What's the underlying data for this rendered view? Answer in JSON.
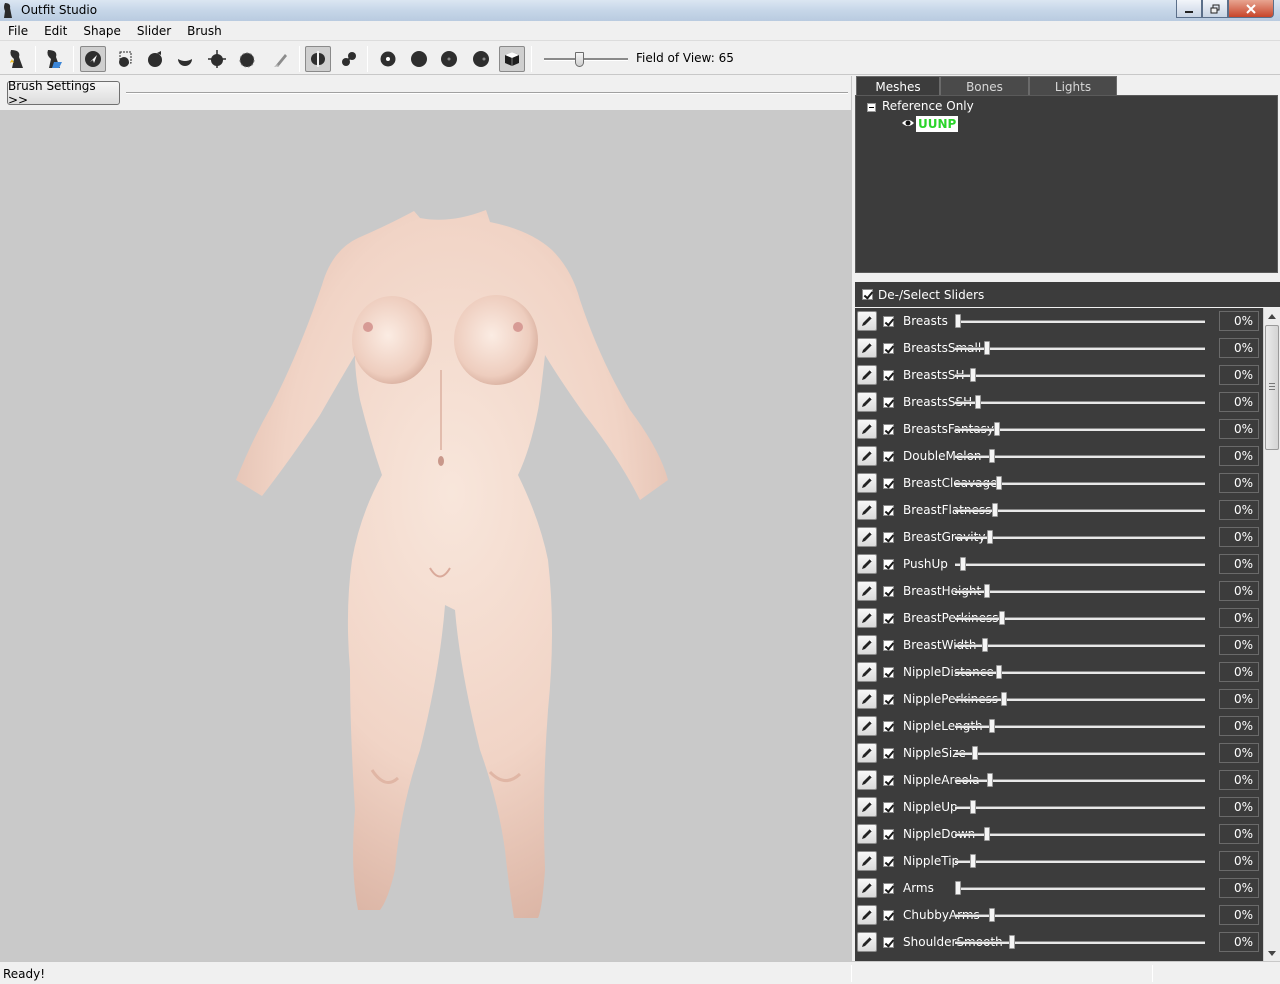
{
  "window": {
    "title": "Outfit Studio",
    "controls": [
      "minimize",
      "maximize",
      "close"
    ]
  },
  "menu": [
    "File",
    "Edit",
    "Shape",
    "Slider",
    "Brush"
  ],
  "toolbar": {
    "field_of_view_label": "Field of View: 65",
    "fov_slider_value": 0.41
  },
  "brush_settings_label": "Brush Settings >>",
  "panel_tabs": [
    "Meshes",
    "Bones",
    "Lights"
  ],
  "mesh_tree": {
    "root": "Reference Only",
    "meshes": [
      "UUNP"
    ]
  },
  "sliders_header": "De-/Select Sliders",
  "sliders": [
    {
      "name": "Breasts",
      "value": "0%",
      "pos": 0.0
    },
    {
      "name": "BreastsSmall",
      "value": "0%",
      "pos": 0.12
    },
    {
      "name": "BreastsSH",
      "value": "0%",
      "pos": 0.06
    },
    {
      "name": "BreastsSSH",
      "value": "0%",
      "pos": 0.08
    },
    {
      "name": "BreastsFantasy",
      "value": "0%",
      "pos": 0.16
    },
    {
      "name": "DoubleMelon",
      "value": "0%",
      "pos": 0.14
    },
    {
      "name": "BreastCleavage",
      "value": "0%",
      "pos": 0.17
    },
    {
      "name": "BreastFlatness",
      "value": "0%",
      "pos": 0.15
    },
    {
      "name": "BreastGravity",
      "value": "0%",
      "pos": 0.13
    },
    {
      "name": "PushUp",
      "value": "0%",
      "pos": 0.02
    },
    {
      "name": "BreastHeight",
      "value": "0%",
      "pos": 0.12
    },
    {
      "name": "BreastPerkiness",
      "value": "0%",
      "pos": 0.18
    },
    {
      "name": "BreastWidth",
      "value": "0%",
      "pos": 0.11
    },
    {
      "name": "NippleDistance",
      "value": "0%",
      "pos": 0.17
    },
    {
      "name": "NipplePerkiness",
      "value": "0%",
      "pos": 0.19
    },
    {
      "name": "NippleLength",
      "value": "0%",
      "pos": 0.14
    },
    {
      "name": "NippleSize",
      "value": "0%",
      "pos": 0.07
    },
    {
      "name": "NippleAreola",
      "value": "0%",
      "pos": 0.13
    },
    {
      "name": "NippleUp",
      "value": "0%",
      "pos": 0.06
    },
    {
      "name": "NippleDown",
      "value": "0%",
      "pos": 0.12
    },
    {
      "name": "NippleTip",
      "value": "0%",
      "pos": 0.06
    },
    {
      "name": "Arms",
      "value": "0%",
      "pos": 0.0
    },
    {
      "name": "ChubbyArms",
      "value": "0%",
      "pos": 0.14
    },
    {
      "name": "ShoulderSmooth",
      "value": "0%",
      "pos": 0.22
    }
  ],
  "status": {
    "text": "Ready!"
  },
  "colors": {
    "panel_bg": "#3c3c3c",
    "viewport_bg": "#c9c9c9",
    "mesh_label": "#2ad42a"
  }
}
